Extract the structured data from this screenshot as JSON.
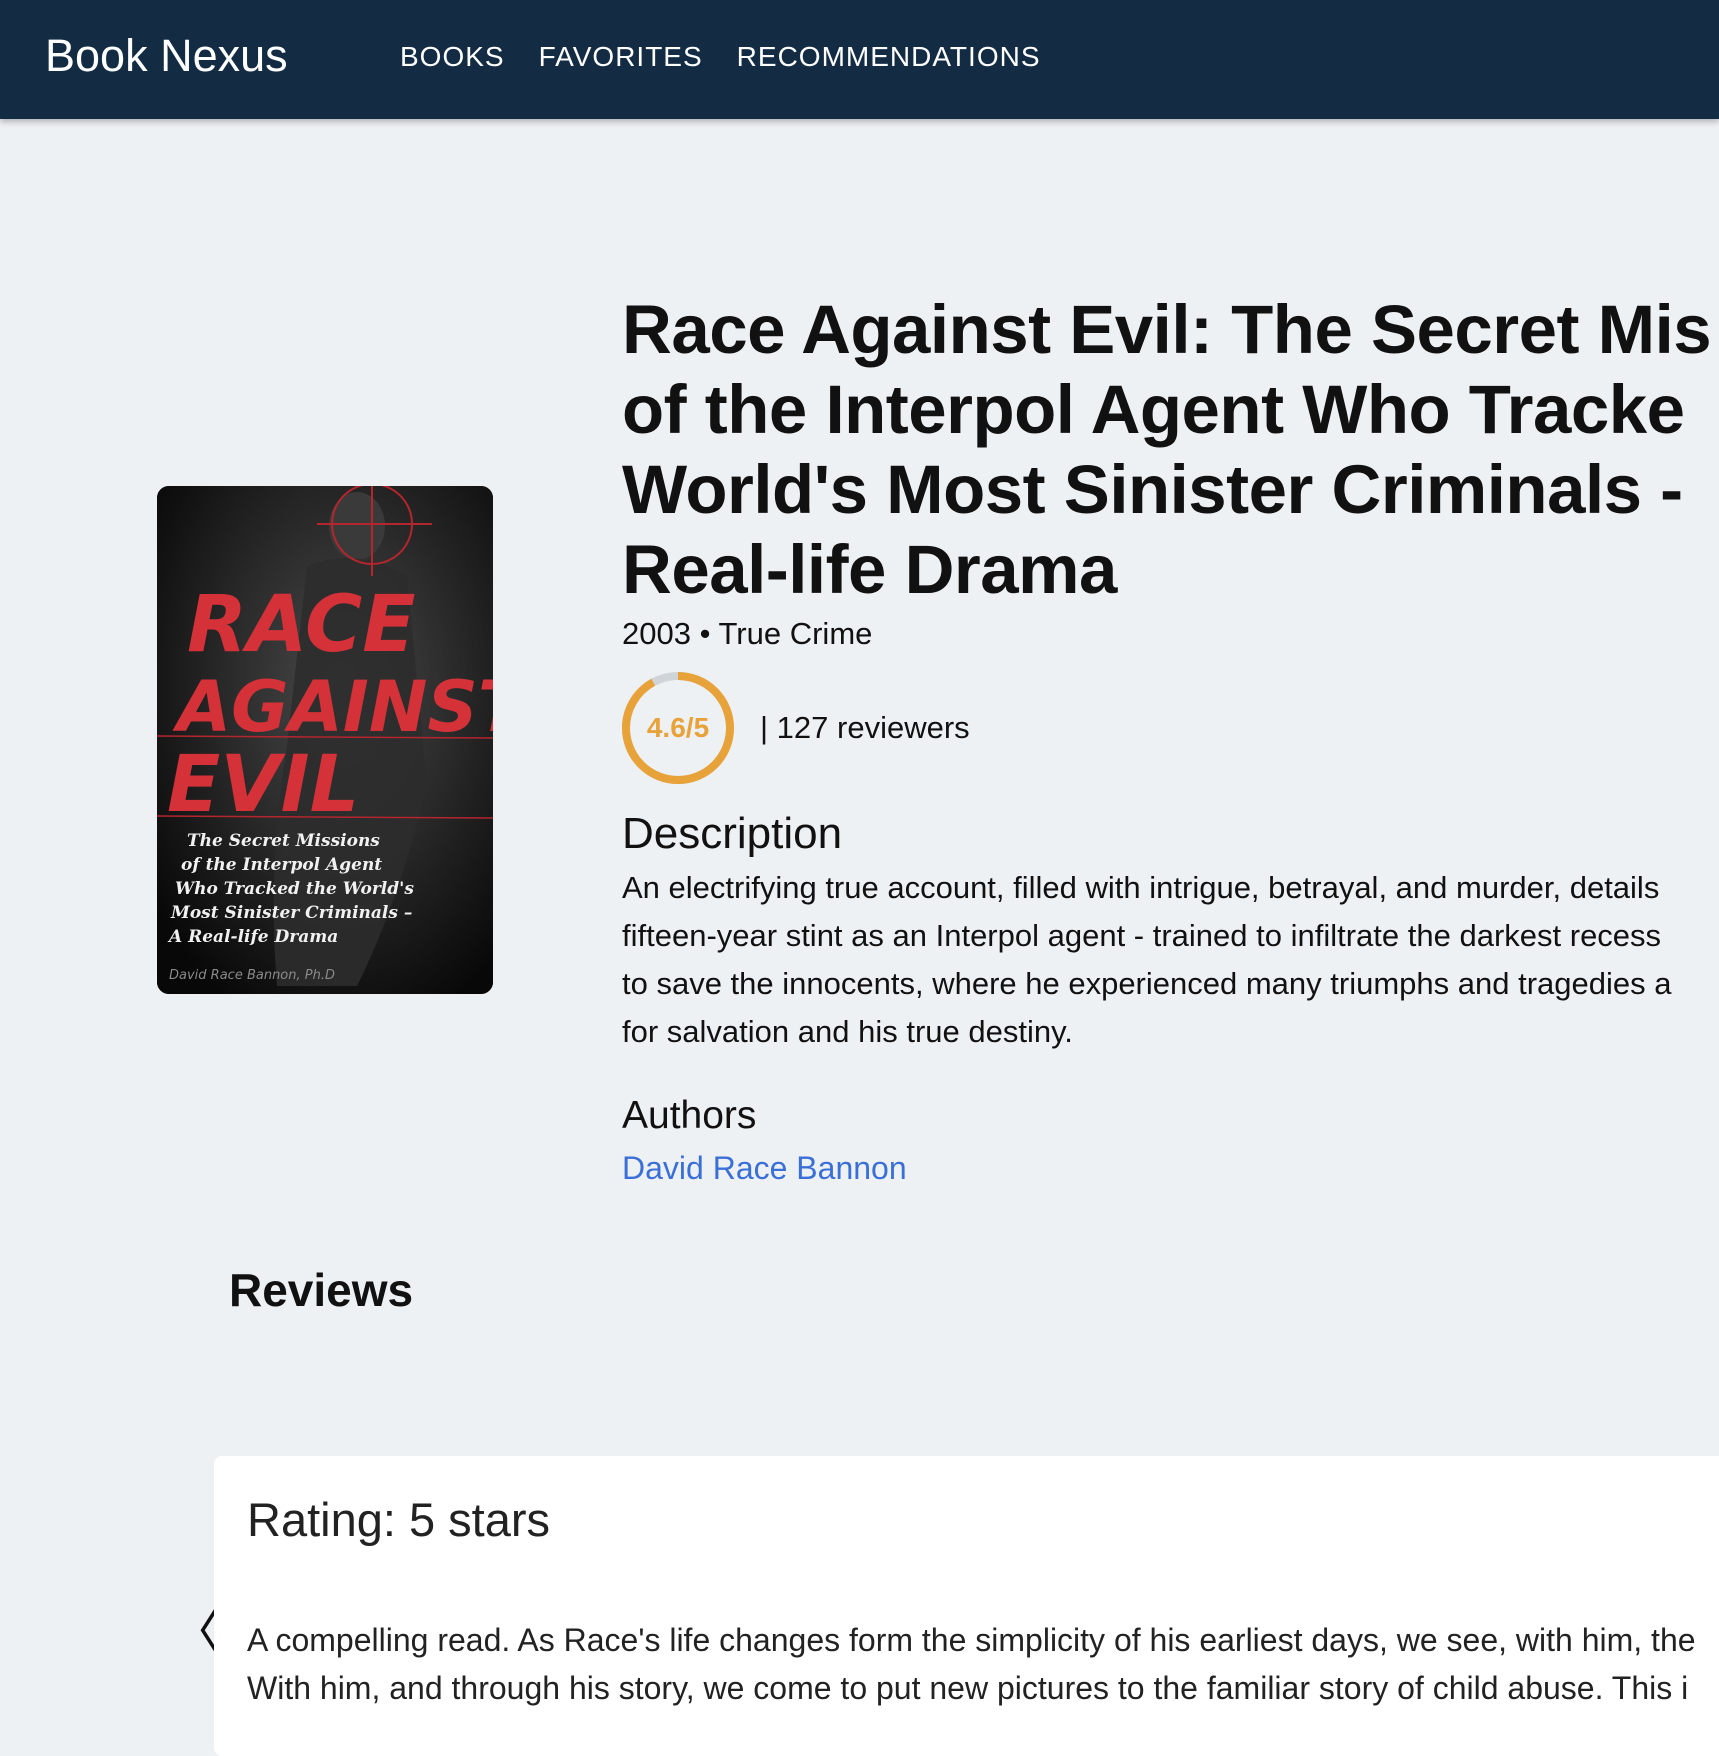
{
  "header": {
    "brand": "Book Nexus",
    "nav": [
      "BOOKS",
      "FAVORITES",
      "RECOMMENDATIONS"
    ]
  },
  "book": {
    "title_lines": [
      "Race Against Evil: The Secret Mis",
      "of the Interpol Agent Who Tracke",
      "World's Most Sinister Criminals -",
      "Real-life Drama"
    ],
    "year": "2003",
    "separator": "•",
    "genre": "True Crime",
    "rating_text": "4.6/5",
    "rating_value": 4.6,
    "rating_max": 5,
    "reviewers_text": "| 127 reviewers",
    "cover": {
      "title_lines": [
        "RACE",
        "AGAINST",
        "EVIL"
      ],
      "subtitle_lines": [
        "The Secret Missions",
        "of the Interpol Agent",
        "Who Tracked the World's",
        "Most Sinister Criminals –",
        "A Real-life Drama"
      ],
      "author": "David Race Bannon, Ph.D"
    }
  },
  "description": {
    "heading": "Description",
    "lines": [
      "An electrifying true account, filled with intrigue, betrayal, and murder, details",
      "fifteen-year stint as an Interpol agent - trained to infiltrate the darkest recess",
      "to save the innocents, where he experienced many triumphs and tragedies a",
      "for salvation and his true destiny."
    ]
  },
  "authors": {
    "heading": "Authors",
    "items": [
      "David Race Bannon"
    ]
  },
  "reviews": {
    "heading": "Reviews",
    "prev_label": "〈",
    "items": [
      {
        "rating_text": "Rating: 5 stars",
        "lines": [
          "A compelling read. As Race's life changes form the simplicity of his earliest days, we see, with him, the",
          "With him, and through his story, we come to put new pictures to the familiar story of child abuse. This i"
        ]
      }
    ]
  },
  "colors": {
    "header_bg": "#132c44",
    "page_bg": "#eef1f4",
    "rating_accent": "#e8a23a",
    "link": "#3b6fd8"
  }
}
